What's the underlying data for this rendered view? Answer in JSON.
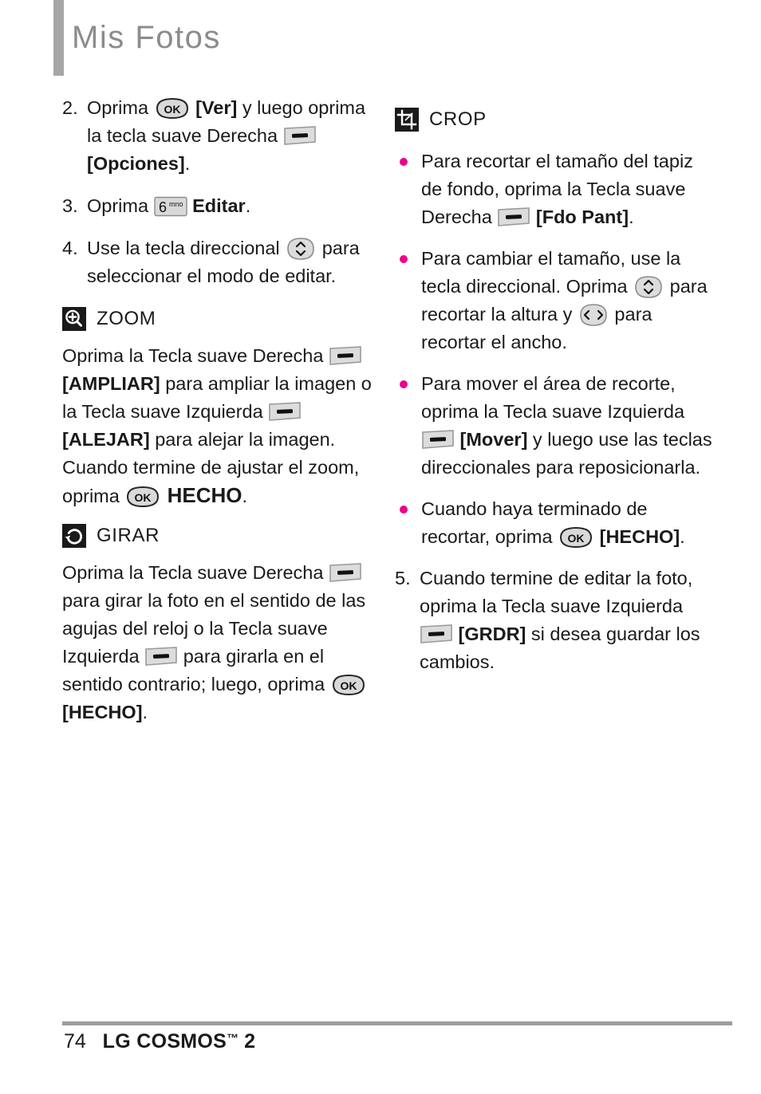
{
  "header": {
    "title": "Mis Fotos"
  },
  "left_column": {
    "steps": [
      {
        "number": "2.",
        "parts": [
          {
            "type": "text",
            "value": "Oprima "
          },
          {
            "type": "key",
            "icon": "ok-key",
            "label": "OK"
          },
          {
            "type": "bold",
            "value": " [Ver]"
          },
          {
            "type": "text",
            "value": " y luego oprima la tecla suave Derecha "
          },
          {
            "type": "key",
            "icon": "soft-key",
            "label": ""
          },
          {
            "type": "bold",
            "value": " [Opciones]"
          },
          {
            "type": "text",
            "value": "."
          }
        ]
      },
      {
        "number": "3.",
        "parts": [
          {
            "type": "text",
            "value": "Oprima "
          },
          {
            "type": "key",
            "icon": "num6-key",
            "label": "6 mno"
          },
          {
            "type": "bold",
            "value": " Editar"
          },
          {
            "type": "text",
            "value": "."
          }
        ]
      },
      {
        "number": "4.",
        "parts": [
          {
            "type": "text",
            "value": "Use la tecla direccional "
          },
          {
            "type": "key",
            "icon": "nav-updown-key",
            "label": ""
          },
          {
            "type": "text",
            "value": " para seleccionar el modo de editar."
          }
        ]
      }
    ],
    "zoom_section": {
      "icon": "zoom-icon",
      "label": "ZOOM",
      "parts": [
        {
          "type": "text",
          "value": "Oprima la Tecla suave Derecha "
        },
        {
          "type": "key",
          "icon": "soft-key",
          "label": ""
        },
        {
          "type": "bold",
          "value": " [AMPLIAR]"
        },
        {
          "type": "text",
          "value": " para ampliar la imagen o la Tecla suave Izquierda "
        },
        {
          "type": "key",
          "icon": "soft-key",
          "label": ""
        },
        {
          "type": "bold",
          "value": " [ALEJAR]"
        },
        {
          "type": "text",
          "value": " para alejar la imagen. Cuando termine de ajustar el zoom, oprima "
        },
        {
          "type": "key",
          "icon": "ok-key",
          "label": "OK"
        },
        {
          "type": "bold-large",
          "value": " HECHO"
        },
        {
          "type": "text",
          "value": "."
        }
      ]
    },
    "rotate_section": {
      "icon": "rotate-icon",
      "label": "GIRAR",
      "parts": [
        {
          "type": "text",
          "value": "Oprima la Tecla suave Derecha "
        },
        {
          "type": "key",
          "icon": "soft-key",
          "label": ""
        },
        {
          "type": "text",
          "value": " para girar la foto en el sentido de las agujas del reloj o la Tecla suave Izquierda "
        },
        {
          "type": "key",
          "icon": "soft-key",
          "label": ""
        },
        {
          "type": "text",
          "value": " para girarla en el sentido contrario; luego, oprima "
        },
        {
          "type": "key",
          "icon": "ok-key",
          "label": "OK"
        },
        {
          "type": "bold",
          "value": " [HECHO]"
        },
        {
          "type": "text",
          "value": "."
        }
      ]
    }
  },
  "right_column": {
    "crop_section": {
      "icon": "crop-icon",
      "label": "CROP",
      "bullets": [
        {
          "parts": [
            {
              "type": "text",
              "value": "Para recortar el tamaño del tapiz de fondo, oprima la Tecla suave Derecha "
            },
            {
              "type": "key",
              "icon": "soft-key",
              "label": ""
            },
            {
              "type": "bold",
              "value": " [Fdo Pant]"
            },
            {
              "type": "text",
              "value": "."
            }
          ]
        },
        {
          "parts": [
            {
              "type": "text",
              "value": "Para cambiar el tamaño, use la tecla direccional. Oprima "
            },
            {
              "type": "key",
              "icon": "nav-updown-key",
              "label": ""
            },
            {
              "type": "text",
              "value": " para recortar la altura y "
            },
            {
              "type": "key",
              "icon": "nav-leftright-key",
              "label": ""
            },
            {
              "type": "text",
              "value": " para recortar el ancho."
            }
          ]
        },
        {
          "parts": [
            {
              "type": "text",
              "value": "Para mover el área de recorte, oprima la Tecla suave Izquierda "
            },
            {
              "type": "key",
              "icon": "soft-key",
              "label": ""
            },
            {
              "type": "bold",
              "value": " [Mover]"
            },
            {
              "type": "text",
              "value": " y luego use las teclas direccionales para reposicionarla."
            }
          ]
        },
        {
          "parts": [
            {
              "type": "text",
              "value": "Cuando haya terminado de recortar, oprima "
            },
            {
              "type": "key",
              "icon": "ok-key",
              "label": "OK"
            },
            {
              "type": "bold",
              "value": " [HECHO]"
            },
            {
              "type": "text",
              "value": "."
            }
          ]
        }
      ]
    },
    "steps": [
      {
        "number": "5.",
        "parts": [
          {
            "type": "text",
            "value": "Cuando termine de editar la foto, oprima la Tecla suave Izquierda "
          },
          {
            "type": "key",
            "icon": "soft-key",
            "label": ""
          },
          {
            "type": "bold",
            "value": " [GRDR]"
          },
          {
            "type": "text",
            "value": " si desea guardar los cambios."
          }
        ]
      }
    ]
  },
  "footer": {
    "page_number": "74",
    "model": "LG COSMOS",
    "trademark": "™",
    "version": "2"
  },
  "colors": {
    "bullet": "#ec008c",
    "title": "#8c8c8c",
    "header_bar": "#a6a6a6",
    "footer_rule": "#9d9d9d",
    "icon_background": "#1a1a1a",
    "text": "#1a1a1a"
  }
}
